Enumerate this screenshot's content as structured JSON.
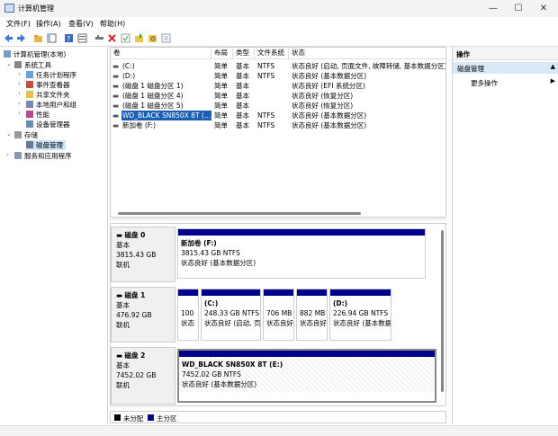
{
  "window": {
    "title": "计算机管理",
    "minimize": "—",
    "maximize": "☐",
    "close": "✕"
  },
  "menu": [
    "文件(F)",
    "操作(A)",
    "查看(V)",
    "帮助(H)"
  ],
  "tree": {
    "root": "计算机管理(本地)",
    "system_tools": "系统工具",
    "task_scheduler": "任务计划程序",
    "event_viewer": "事件查看器",
    "shared_folders": "共享文件夹",
    "local_users": "本地用户和组",
    "performance": "性能",
    "device_manager": "设备管理器",
    "storage": "存储",
    "disk_management": "磁盘管理",
    "services_apps": "服务和应用程序"
  },
  "table": {
    "headers": [
      "卷",
      "布局",
      "类型",
      "文件系统",
      "状态"
    ],
    "rows": [
      {
        "vol": "(C:)",
        "layout": "简单",
        "type": "基本",
        "fs": "NTFS",
        "status": "状态良好 (启动, 页面文件, 故障转储, 基本数据分区)"
      },
      {
        "vol": "(D:)",
        "layout": "简单",
        "type": "基本",
        "fs": "NTFS",
        "status": "状态良好 (基本数据分区)"
      },
      {
        "vol": "(磁盘 1 磁盘分区 1)",
        "layout": "简单",
        "type": "基本",
        "fs": "",
        "status": "状态良好 (EFI 系统分区)"
      },
      {
        "vol": "(磁盘 1 磁盘分区 4)",
        "layout": "简单",
        "type": "基本",
        "fs": "",
        "status": "状态良好 (恢复分区)"
      },
      {
        "vol": "(磁盘 1 磁盘分区 5)",
        "layout": "简单",
        "type": "基本",
        "fs": "",
        "status": "状态良好 (恢复分区)"
      },
      {
        "vol": "WD_BLACK SN850X 8T (…",
        "layout": "简单",
        "type": "基本",
        "fs": "NTFS",
        "status": "状态良好 (基本数据分区)"
      },
      {
        "vol": "新加卷 (F:)",
        "layout": "简单",
        "type": "基本",
        "fs": "NTFS",
        "status": "状态良好 (基本数据分区)"
      }
    ]
  },
  "disks": [
    {
      "name": "磁盘 0",
      "type": "基本",
      "size": "3815.43 GB",
      "state": "联机"
    },
    {
      "name": "磁盘 1",
      "type": "基本",
      "size": "476.92 GB",
      "state": "联机"
    },
    {
      "name": "磁盘 2",
      "type": "基本",
      "size": "7452.02 GB",
      "state": "联机"
    }
  ],
  "partitions": {
    "d0p1": {
      "name": "新加卷 (F:)",
      "size": "3815.43 GB NTFS",
      "status": "状态良好 (基本数据分区)"
    },
    "d1p1": {
      "name": "",
      "size": "100",
      "status": "状态"
    },
    "d1p2": {
      "name": "(C:)",
      "size": "248.33 GB NTFS",
      "status": "状态良好 (启动, 页"
    },
    "d1p3": {
      "name": "",
      "size": "706 MB",
      "status": "状态良好"
    },
    "d1p4": {
      "name": "",
      "size": "882 MB",
      "status": "状态良好"
    },
    "d1p5": {
      "name": "(D:)",
      "size": "226.94 GB NTFS",
      "status": "状态良好 (基本数据分区)"
    },
    "d2p1": {
      "name": "WD_BLACK SN850X 8T  (E:)",
      "size": "7452.02 GB NTFS",
      "status": "状态良好 (基本数据分区)"
    }
  },
  "legend": {
    "unallocated": "未分配",
    "primary": "主分区"
  },
  "actions": {
    "header": "操作",
    "section": "磁盘管理",
    "more": "更多操作"
  },
  "colors": {
    "primary_partition": "#00008b",
    "unallocated": "#000000",
    "selection": "#1a5fb4"
  }
}
